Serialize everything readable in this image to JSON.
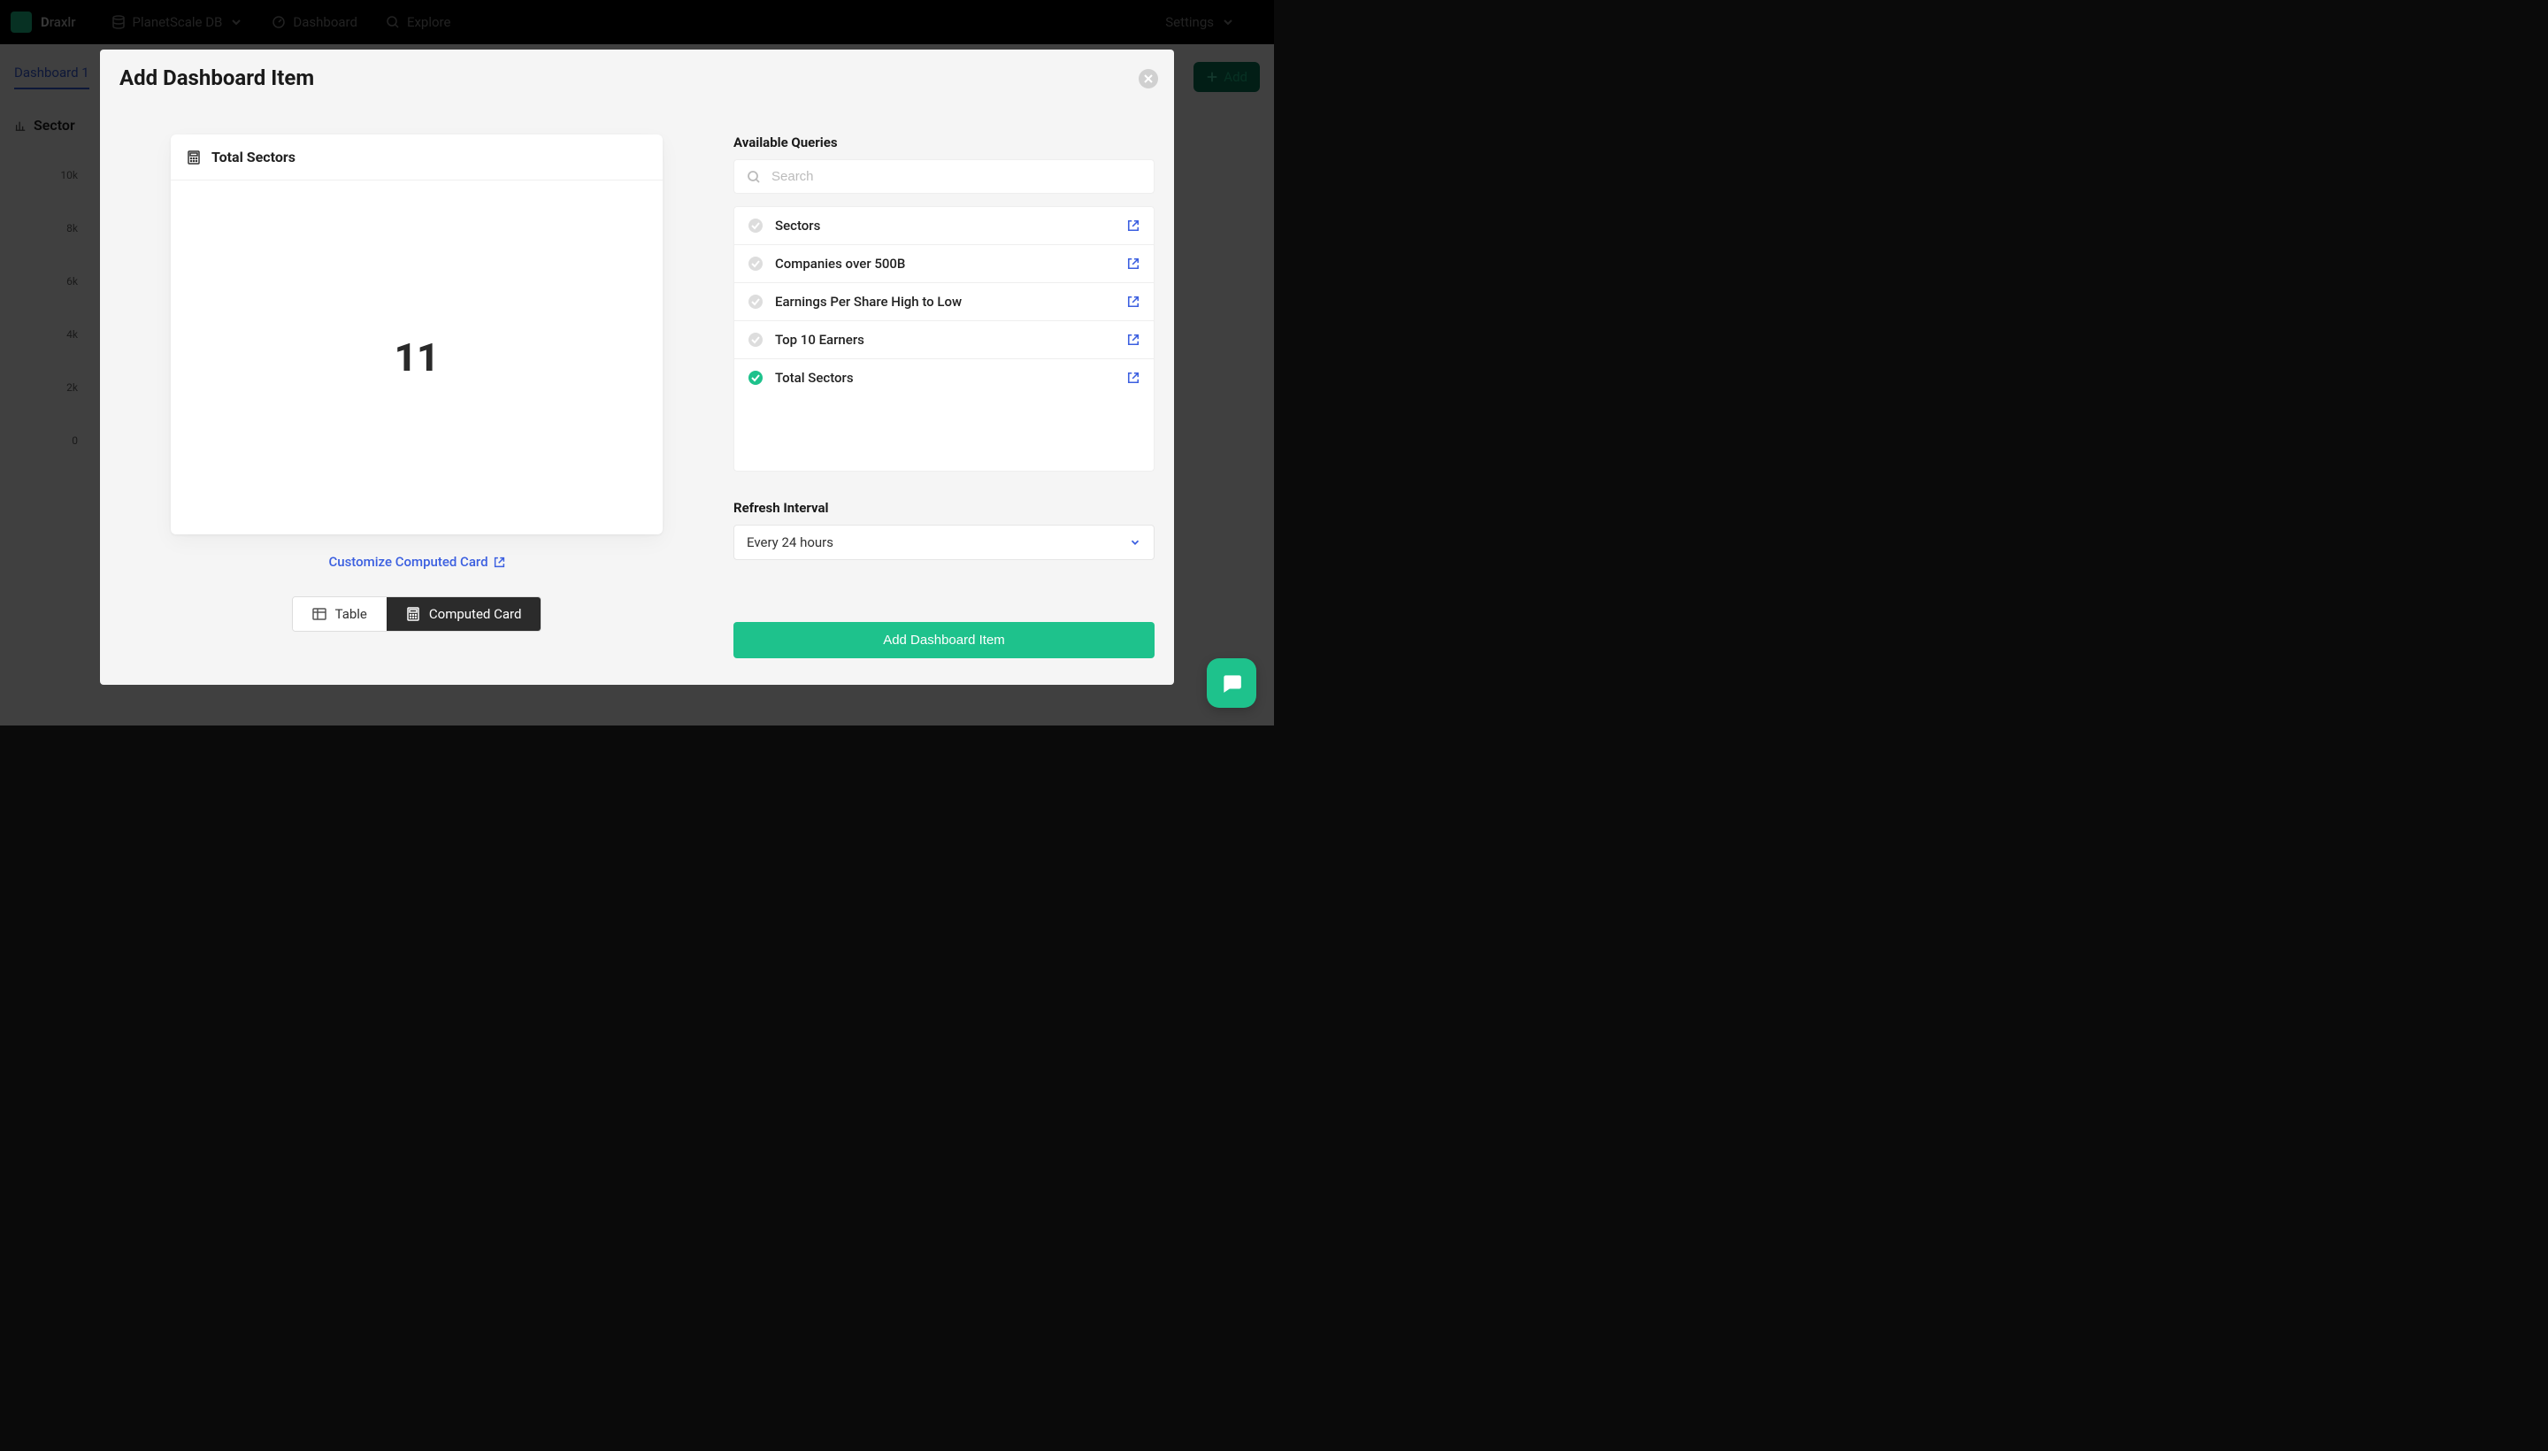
{
  "nav": {
    "brand": "Draxlr",
    "db": "PlanetScale DB",
    "dashboard": "Dashboard",
    "explore": "Explore",
    "settings": "Settings"
  },
  "bg": {
    "tab": "Dashboard 1",
    "add": "Add",
    "chart_title": "Sector",
    "yticks": [
      "10k",
      "8k",
      "6k",
      "4k",
      "2k",
      "0"
    ]
  },
  "modal": {
    "title": "Add Dashboard Item",
    "preview": {
      "title": "Total Sectors",
      "value": "11"
    },
    "customize_link": "Customize Computed Card",
    "toggle": {
      "table": "Table",
      "computed": "Computed Card"
    },
    "queries_label": "Available Queries",
    "search_placeholder": "Search",
    "queries": [
      {
        "label": "Sectors",
        "selected": false
      },
      {
        "label": "Companies over 500B",
        "selected": false
      },
      {
        "label": "Earnings Per Share High to Low",
        "selected": false
      },
      {
        "label": "Top 10 Earners",
        "selected": false
      },
      {
        "label": "Total Sectors",
        "selected": true
      }
    ],
    "refresh_label": "Refresh Interval",
    "refresh_value": "Every 24 hours",
    "submit": "Add Dashboard Item"
  }
}
